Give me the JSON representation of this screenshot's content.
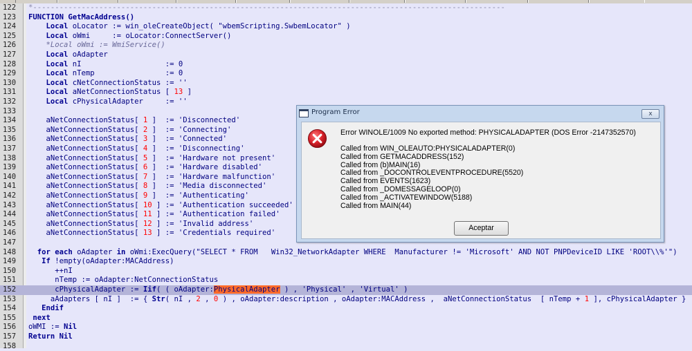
{
  "editor": {
    "lines": [
      {
        "n": "122",
        "text": "*-----------------------------------------------------------------------------------------------------------",
        "cls": "dash"
      },
      {
        "n": "123",
        "text": "FUNCTION GetMacAddress()",
        "cls": "kw"
      },
      {
        "n": "124",
        "text": "    Local oLocator := win_oleCreateObject( \"wbemScripting.SwbemLocator\" )",
        "cls": ""
      },
      {
        "n": "125",
        "text": "    Local oWmi     := oLocator:ConnectServer()",
        "cls": ""
      },
      {
        "n": "126",
        "text": "    *Local oWmi := WmiService()",
        "cls": "cmt"
      },
      {
        "n": "127",
        "text": "    Local oAdapter",
        "cls": ""
      },
      {
        "n": "128",
        "text": "    Local nI                   := 0",
        "cls": ""
      },
      {
        "n": "129",
        "text": "    Local nTemp                := 0",
        "cls": ""
      },
      {
        "n": "130",
        "text": "    Local cNetConnectionStatus := ''",
        "cls": ""
      },
      {
        "n": "131",
        "text": "    Local aNetConnectionStatus [ 13 ]",
        "cls": ""
      },
      {
        "n": "132",
        "text": "    Local cPhysicalAdapter     := ''",
        "cls": ""
      },
      {
        "n": "133",
        "text": "",
        "cls": ""
      },
      {
        "n": "134",
        "text": "    aNetConnectionStatus[ 1 ]  := 'Disconnected'",
        "cls": ""
      },
      {
        "n": "135",
        "text": "    aNetConnectionStatus[ 2 ]  := 'Connecting'",
        "cls": ""
      },
      {
        "n": "136",
        "text": "    aNetConnectionStatus[ 3 ]  := 'Connected'",
        "cls": ""
      },
      {
        "n": "137",
        "text": "    aNetConnectionStatus[ 4 ]  := 'Disconnecting'",
        "cls": ""
      },
      {
        "n": "138",
        "text": "    aNetConnectionStatus[ 5 ]  := 'Hardware not present'",
        "cls": ""
      },
      {
        "n": "139",
        "text": "    aNetConnectionStatus[ 6 ]  := 'Hardware disabled'",
        "cls": ""
      },
      {
        "n": "140",
        "text": "    aNetConnectionStatus[ 7 ]  := 'Hardware malfunction'",
        "cls": ""
      },
      {
        "n": "141",
        "text": "    aNetConnectionStatus[ 8 ]  := 'Media disconnected'",
        "cls": ""
      },
      {
        "n": "142",
        "text": "    aNetConnectionStatus[ 9 ]  := 'Authenticating'",
        "cls": ""
      },
      {
        "n": "143",
        "text": "    aNetConnectionStatus[ 10 ] := 'Authentication succeeded'",
        "cls": ""
      },
      {
        "n": "144",
        "text": "    aNetConnectionStatus[ 11 ] := 'Authentication failed'",
        "cls": ""
      },
      {
        "n": "145",
        "text": "    aNetConnectionStatus[ 12 ] := 'Invalid address'",
        "cls": ""
      },
      {
        "n": "146",
        "text": "    aNetConnectionStatus[ 13 ] := 'Credentials required'",
        "cls": ""
      },
      {
        "n": "147",
        "text": "",
        "cls": ""
      },
      {
        "n": "148",
        "text": "  for each oAdapter in oWmi:ExecQuery(\"SELECT * FROM   Win32_NetworkAdapter WHERE  Manufacturer != 'Microsoft' AND NOT PNPDeviceID LIKE 'ROOT\\\\%'\")",
        "cls": ""
      },
      {
        "n": "149",
        "text": "   If !empty(oAdapter:MACAddress)",
        "cls": ""
      },
      {
        "n": "150",
        "text": "      ++nI",
        "cls": ""
      },
      {
        "n": "151",
        "text": "      nTemp := oAdapter:NetConnectionStatus",
        "cls": ""
      },
      {
        "n": "152",
        "text": "      cPhysicalAdapter := Iif( ( oAdapter:PhysicalAdapter ) , 'Physical' , 'Virtual' )",
        "cls": "hl"
      },
      {
        "n": "153",
        "text": "     aAdapters [ nI ]  := { Str( nI , 2 , 0 ) , oAdapter:description , oAdapter:MACAddress ,  aNetConnectionStatus  [ nTemp + 1 ], cPhysicalAdapter }",
        "cls": ""
      },
      {
        "n": "154",
        "text": "   Endif",
        "cls": ""
      },
      {
        "n": "155",
        "text": " next",
        "cls": ""
      },
      {
        "n": "156",
        "text": "oWMI := Nil",
        "cls": ""
      },
      {
        "n": "157",
        "text": "Return Nil",
        "cls": ""
      },
      {
        "n": "158",
        "text": "",
        "cls": ""
      }
    ],
    "selected_token": "PhysicalAdapter"
  },
  "dialog": {
    "title": "Program Error",
    "close_label": "x",
    "icon": "error-icon",
    "message": "Error WINOLE/1009  No exported method: PHYSICALADAPTER (DOS Error -2147352570)",
    "stack": [
      "Called from WIN_OLEAUTO:PHYSICALADAPTER(0)",
      "Called from GETMACADDRESS(152)",
      "Called from (b)MAIN(16)",
      "Called from _DOCONTROLEVENTPROCEDURE(5520)",
      "Called from EVENTS(1623)",
      "Called from _DOMESSAGELOOP(0)",
      "Called from _ACTIVATEWINDOW(5188)",
      "Called from MAIN(44)"
    ],
    "ok_label": "Aceptar"
  },
  "colors": {
    "editor_bg": "#e6e6fa",
    "highlight_line": "#b4b4d8",
    "selection": "#ff6a2a",
    "error_red": "#d21f1f"
  }
}
